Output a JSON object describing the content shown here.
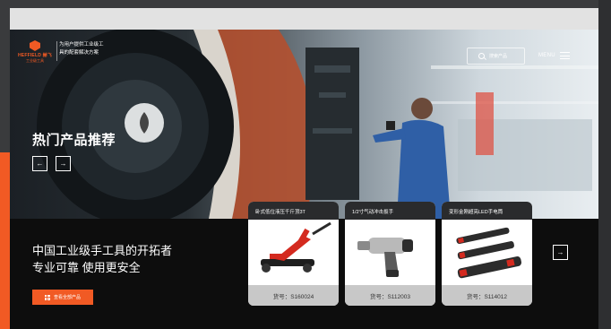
{
  "brand": {
    "name": "HEFFIELD 赫飞",
    "sub": "工业级工具",
    "tagline": "为用户提供工业级工具的配套解决方案"
  },
  "header": {
    "search_placeholder": "搜索产品",
    "menu_label": "MENU"
  },
  "hero": {
    "title": "热门产品推荐",
    "prev_icon": "←",
    "next_icon": "→"
  },
  "promo": {
    "line1": "中国工业级手工具的开拓者",
    "line2": "专业可靠 使用更安全",
    "cta_label": "查看全部产品"
  },
  "products": [
    {
      "name": "卧式低位液压千斤顶3T",
      "code": "货号：S160024"
    },
    {
      "name": "1/2寸气动冲击扳手",
      "code": "货号：S112003"
    },
    {
      "name": "变形金刚超亮LED手电筒",
      "code": "货号：S114012"
    }
  ],
  "carousel": {
    "next_icon": "→"
  },
  "colors": {
    "accent": "#f15a24",
    "dark": "#0d0d0d",
    "card_foot": "#c8c8c8"
  }
}
